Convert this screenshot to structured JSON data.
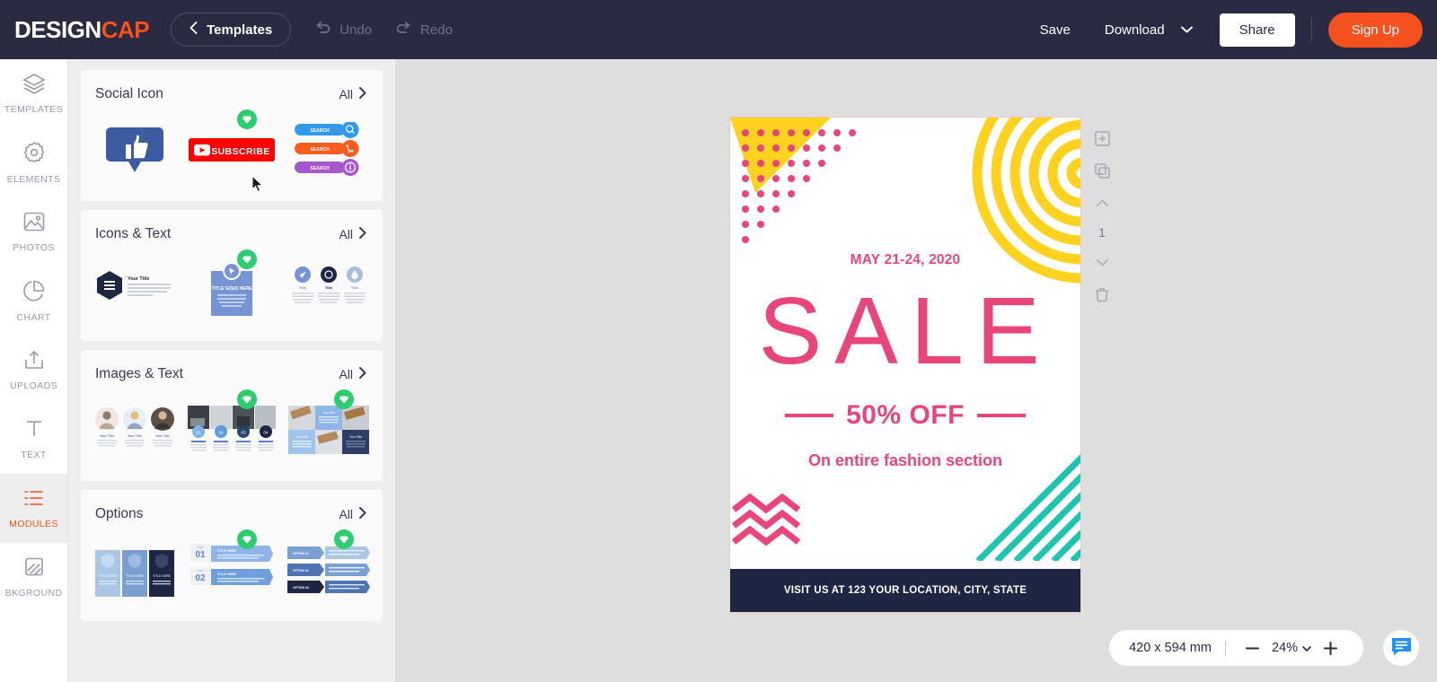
{
  "header": {
    "logo_design": "DESIGN",
    "logo_cap": "CAP",
    "templates_label": "Templates",
    "back_icon": "chevron-left-icon",
    "undo_label": "Undo",
    "undo_icon": "undo-arrow-icon",
    "redo_label": "Redo",
    "redo_icon": "redo-arrow-icon",
    "save_label": "Save",
    "download_label": "Download",
    "download_caret_icon": "chevron-down-icon",
    "share_label": "Share",
    "signup_label": "Sign Up",
    "accent_color": "#f4511e",
    "bg_color": "#2a2a42"
  },
  "sidebar": {
    "active": "MODULES",
    "active_color": "#f4511e",
    "items": [
      {
        "label": "TEMPLATES",
        "icon": "layers-icon"
      },
      {
        "label": "ELEMENTS",
        "icon": "badge-star-icon"
      },
      {
        "label": "PHOTOS",
        "icon": "image-icon"
      },
      {
        "label": "CHART",
        "icon": "pie-chart-icon"
      },
      {
        "label": "UPLOADS",
        "icon": "upload-icon"
      },
      {
        "label": "TEXT",
        "icon": "text-t-icon"
      },
      {
        "label": "MODULES",
        "icon": "list-bullet-icon"
      },
      {
        "label": "BKGROUND",
        "icon": "background-fill-icon"
      }
    ]
  },
  "panel": {
    "all_label": "All",
    "all_icon": "chevron-right-icon",
    "pro_badge_icon": "diamond-gem-icon",
    "pro_badge_color": "#2ecc71",
    "sections": [
      {
        "title": "Social Icon",
        "thumbs": [
          {
            "name": "facebook-like-thumb",
            "pro": false
          },
          {
            "name": "youtube-subscribe-thumb",
            "pro": true,
            "label": "SUBSCRIBE"
          },
          {
            "name": "search-buttons-thumb",
            "pro": false,
            "label": "SEARCH"
          }
        ]
      },
      {
        "title": "Icons & Text",
        "thumbs": [
          {
            "name": "hexagon-icon-text-thumb",
            "pro": false,
            "label": "Your Title"
          },
          {
            "name": "blue-card-title-thumb",
            "pro": true,
            "label": "TITLE GOES HERE"
          },
          {
            "name": "three-circle-icons-thumb",
            "pro": false,
            "label": "Title"
          }
        ]
      },
      {
        "title": "Images & Text",
        "thumbs": [
          {
            "name": "avatar-profiles-thumb",
            "pro": false
          },
          {
            "name": "photo-feature-row-thumb",
            "pro": true
          },
          {
            "name": "photo-grid-thumb",
            "pro": true
          }
        ]
      },
      {
        "title": "Options",
        "thumbs": [
          {
            "name": "three-column-options-thumb",
            "pro": false
          },
          {
            "name": "numbered-steps-thumb",
            "pro": true,
            "label": "01"
          },
          {
            "name": "stacked-options-thumb",
            "pro": true,
            "label": "OPTION 01"
          }
        ]
      }
    ]
  },
  "poster": {
    "date": "MAY 21-24, 2020",
    "headline": "SALE",
    "discount": "50% OFF",
    "subtitle": "On entire fashion section",
    "footer": "VISIT US AT 123 YOUR LOCATION, CITY, STATE",
    "pink": "#e8457b",
    "yellow": "#ffd21f",
    "teal": "#1fc4b0",
    "navy": "#1d2643"
  },
  "page_tools": {
    "add_page_icon": "add-page-icon",
    "duplicate_icon": "duplicate-page-icon",
    "move_up_icon": "chevron-up-icon",
    "page_number": "1",
    "move_down_icon": "chevron-down-icon",
    "delete_icon": "trash-icon"
  },
  "statusbar": {
    "dimensions": "420 x 594 mm",
    "zoom_out_icon": "minus-icon",
    "zoom_value": "24%",
    "zoom_caret_icon": "chevron-down-icon",
    "zoom_in_icon": "plus-icon",
    "chat_icon": "chat-bubble-icon",
    "chat_color": "#1e90ff"
  }
}
